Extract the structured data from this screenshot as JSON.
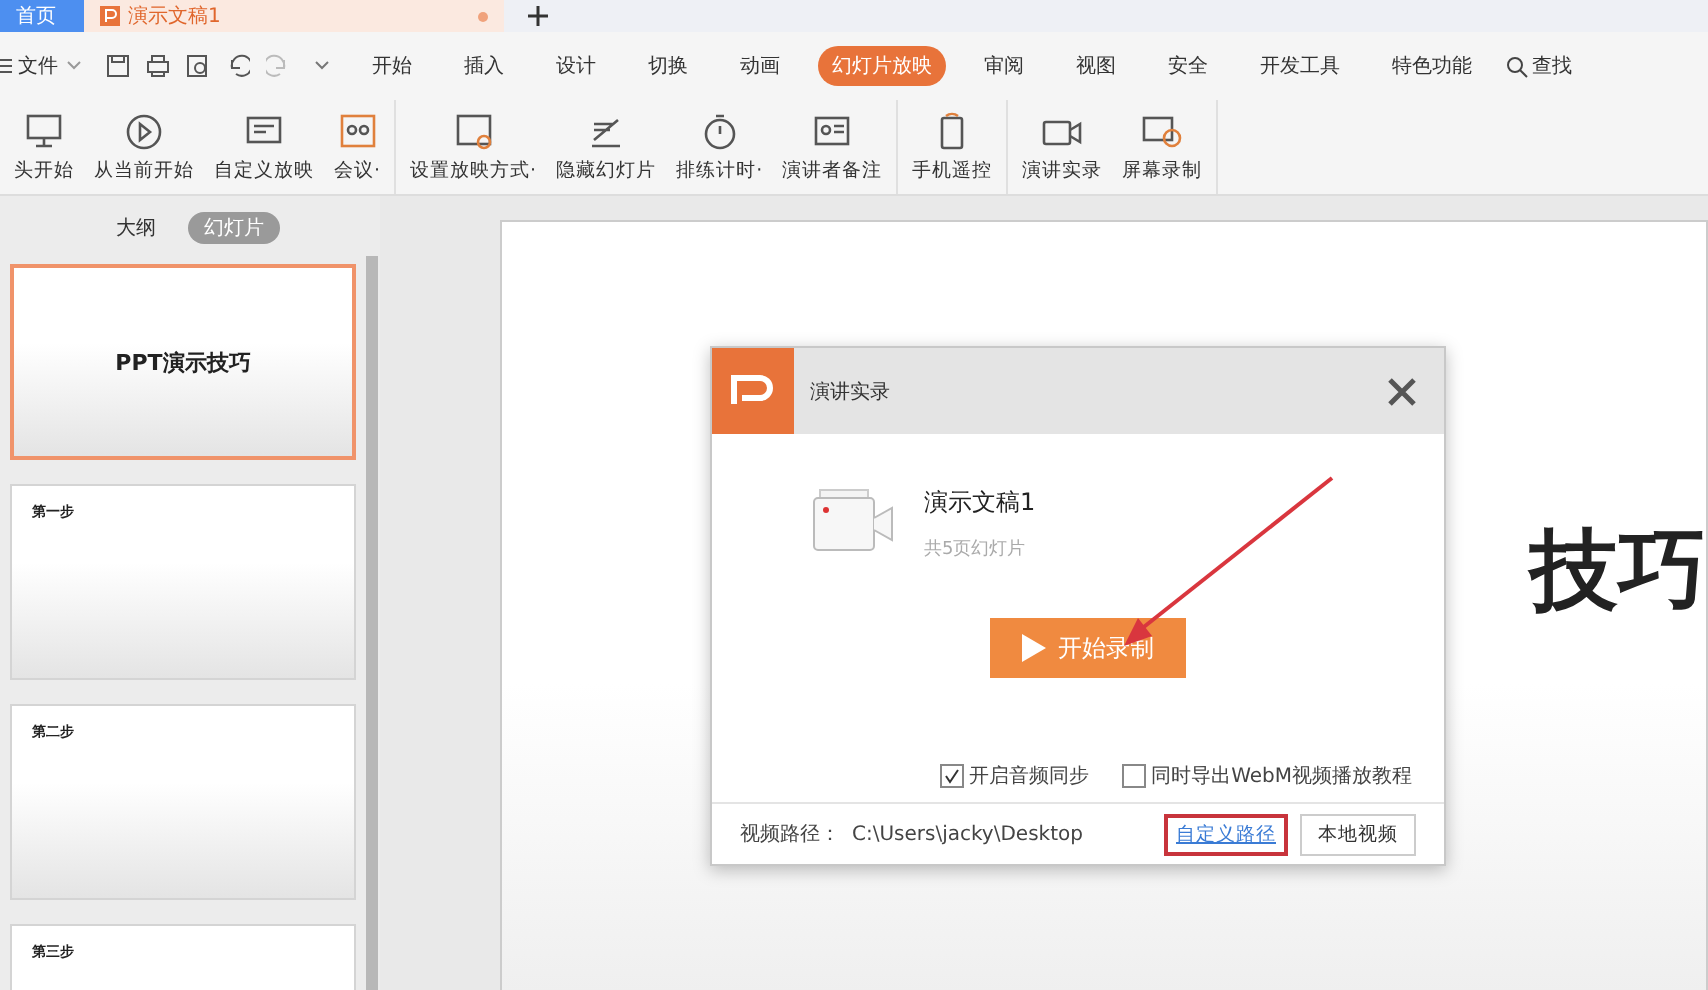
{
  "doc_tabs": [
    {
      "label": "首页",
      "kind": "home"
    },
    {
      "label": "演示文稿1",
      "kind": "doc"
    }
  ],
  "menu": {
    "file": "文件",
    "tabs": [
      {
        "label": "开始",
        "selected": false
      },
      {
        "label": "插入",
        "selected": false
      },
      {
        "label": "设计",
        "selected": false
      },
      {
        "label": "切换",
        "selected": false
      },
      {
        "label": "动画",
        "selected": false
      },
      {
        "label": "幻灯片放映",
        "selected": true
      },
      {
        "label": "审阅",
        "selected": false
      },
      {
        "label": "视图",
        "selected": false
      },
      {
        "label": "安全",
        "selected": false
      },
      {
        "label": "开发工具",
        "selected": false
      },
      {
        "label": "特色功能",
        "selected": false
      }
    ],
    "search": "查找"
  },
  "ribbon": [
    [
      {
        "label": "头开始",
        "kind": "monitor"
      },
      {
        "label": "从当前开始",
        "kind": "play"
      },
      {
        "label": "自定义放映",
        "kind": "slides"
      },
      {
        "label": "会议·",
        "kind": "meeting"
      }
    ],
    [
      {
        "label": "设置放映方式·",
        "kind": "settings"
      },
      {
        "label": "隐藏幻灯片",
        "kind": "hide"
      },
      {
        "label": "排练计时·",
        "kind": "timer"
      },
      {
        "label": "演讲者备注",
        "kind": "notes"
      }
    ],
    [
      {
        "label": "手机遥控",
        "kind": "phone"
      }
    ],
    [
      {
        "label": "演讲实录",
        "kind": "camera"
      },
      {
        "label": "屏幕录制",
        "kind": "screen"
      }
    ]
  ],
  "panel": {
    "tabs": [
      {
        "label": "大纲",
        "selected": false
      },
      {
        "label": "幻灯片",
        "selected": true
      }
    ],
    "slides": [
      {
        "title": "PPT演示技巧",
        "kind": "cover",
        "selected": true
      },
      {
        "title": "第一步",
        "kind": "content",
        "selected": false
      },
      {
        "title": "第二步",
        "kind": "content",
        "selected": false
      },
      {
        "title": "第三步",
        "kind": "content",
        "selected": false
      }
    ]
  },
  "slide": {
    "title_visible": "技巧"
  },
  "dialog": {
    "title": "演讲实录",
    "file_name": "演示文稿1",
    "slide_count": "共5页幻灯片",
    "start_button": "开始录制",
    "options": [
      {
        "label": "开启音频同步",
        "checked": true
      },
      {
        "label": "同时导出WebM视频播放教程",
        "checked": false
      }
    ],
    "path_label": "视频路径：",
    "path": "C:\\Users\\jacky\\Desktop",
    "custom_path": "自定义路径",
    "local_video": "本地视频"
  }
}
